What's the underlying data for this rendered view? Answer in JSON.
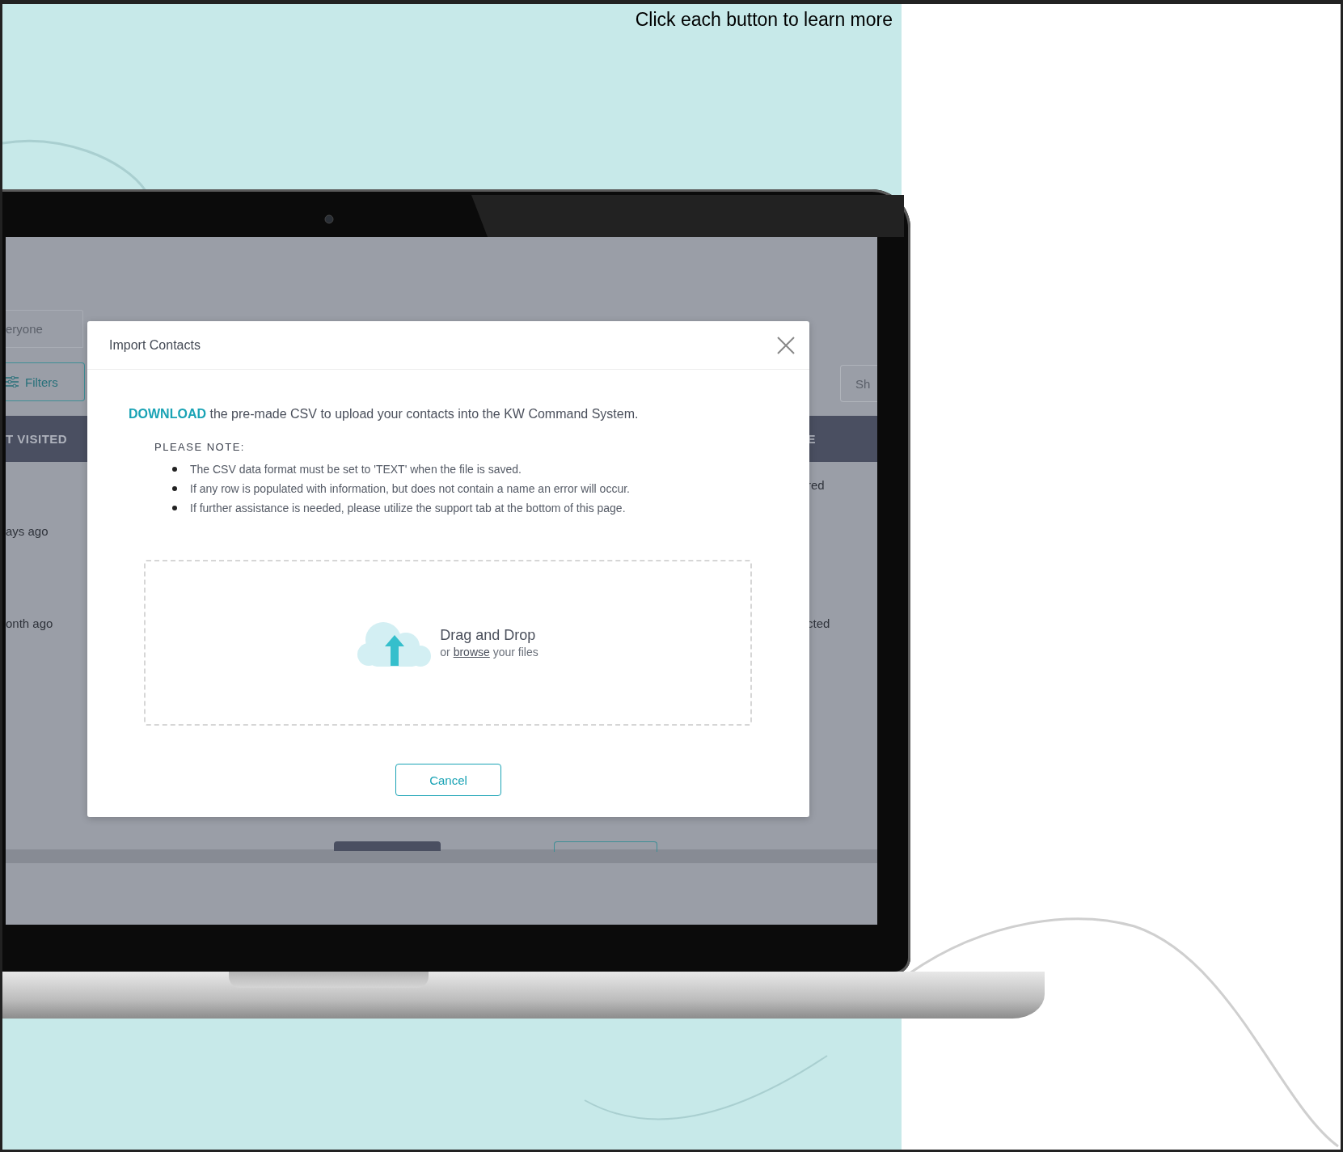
{
  "header": {
    "text": "Click each button to learn more"
  },
  "background_app": {
    "search": {
      "value": "eryone"
    },
    "filters_button": {
      "label": "Filters"
    },
    "show_button": {
      "label": "Sh"
    },
    "table": {
      "column_1": "T VISITED",
      "column_2": "E",
      "left_cells": [
        "ays ago",
        "onth ago"
      ],
      "right_cells": [
        "red",
        "cted"
      ]
    }
  },
  "modal": {
    "title": "Import Contacts",
    "intro": "**DOWNLOAD** the pre-made CSV to upload your contacts into the KW Command System.",
    "note_heading": "PLEASE NOTE:",
    "notes": [
      "The CSV data format must be set to 'TEXT' when the file is saved.",
      "If any row is populated with information, but does not contain a name an error will occur.",
      "If further assistance is needed, please utilize the support tab at the bottom of this page."
    ],
    "dropzone": {
      "title": "Drag and Drop",
      "hint_before": "or",
      "link": "browse",
      "hint_after": "your files"
    },
    "buttons": [
      {
        "label": "Cancel"
      }
    ]
  }
}
